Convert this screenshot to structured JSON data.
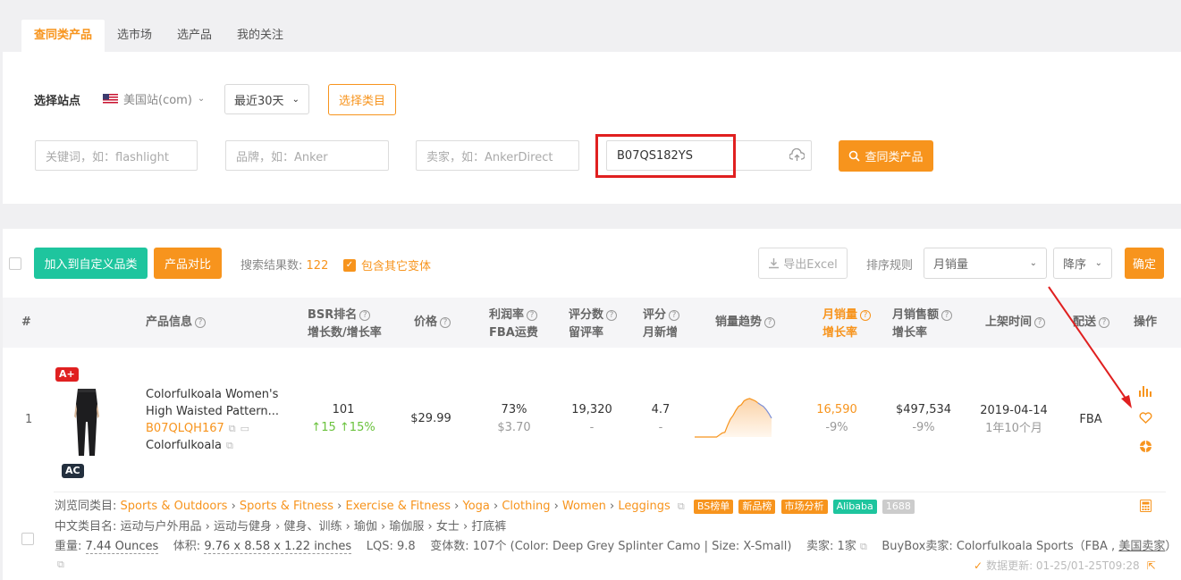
{
  "tabs": [
    {
      "label": "查同类产品",
      "active": true
    },
    {
      "label": "选市场",
      "active": false
    },
    {
      "label": "选产品",
      "active": false
    },
    {
      "label": "我的关注",
      "active": false
    }
  ],
  "filters": {
    "site_label": "选择站点",
    "site_value": "美国站(com)",
    "period_value": "最近30天",
    "category_button": "选择类目",
    "keyword_placeholder": "关键词，如：flashlight",
    "brand_placeholder": "品牌，如：Anker",
    "seller_placeholder": "卖家，如：AnkerDirect",
    "asin_value": "B07QS182YS",
    "search_button": "查同类产品"
  },
  "toolbar": {
    "add_custom": "加入到自定义品类",
    "compare": "产品对比",
    "result_label": "搜索结果数:",
    "result_count": "122",
    "include_variants": "包含其它变体",
    "export": "导出Excel",
    "sort_label": "排序规则",
    "sort_field": "月销量",
    "sort_order": "降序",
    "confirm": "确定"
  },
  "columns": {
    "index": "#",
    "product_info": "产品信息",
    "bsr_1": "BSR排名",
    "bsr_2": "增长数/增长率",
    "price": "价格",
    "margin_1": "利润率",
    "margin_2": "FBA运费",
    "reviews_1": "评分数",
    "reviews_2": "留评率",
    "rating_1": "评分",
    "rating_2": "月新增",
    "trend": "销量趋势",
    "sales_1": "月销量",
    "sales_2": "增长率",
    "revenue_1": "月销售额",
    "revenue_2": "增长率",
    "listed": "上架时间",
    "fulfill": "配送",
    "ops": "操作"
  },
  "row": {
    "index": "1",
    "badge_top": "A+",
    "badge_bottom": "AC",
    "title_1": "Colorfulkoala Women's",
    "title_2": "High Waisted Pattern...",
    "asin": "B07QLQH167",
    "brand": "Colorfulkoala",
    "bsr": "101",
    "bsr_growth": "15",
    "bsr_rate": "15%",
    "price": "$29.99",
    "margin": "73%",
    "fba_fee": "$3.70",
    "reviews": "19,320",
    "review_rate": "-",
    "rating": "4.7",
    "rating_new": "-",
    "monthly_sales": "16,590",
    "sales_growth": "-9%",
    "monthly_revenue": "$497,534",
    "revenue_growth": "-9%",
    "listed_date": "2019-04-14",
    "listed_age": "1年10个月",
    "fulfillment": "FBA"
  },
  "details": {
    "browse_label": "浏览同类目:",
    "browse_path": [
      "Sports & Outdoors",
      "Sports & Fitness",
      "Exercise & Fitness",
      "Yoga",
      "Clothing",
      "Women",
      "Leggings"
    ],
    "tags": [
      {
        "label": "BS榜单",
        "color": "#f7941d"
      },
      {
        "label": "新品榜",
        "color": "#f7941d"
      },
      {
        "label": "市场分析",
        "color": "#f7941d"
      },
      {
        "label": "Alibaba",
        "color": "#1ec59e"
      },
      {
        "label": "1688",
        "color": "#cccccc"
      }
    ],
    "cn_category_label": "中文类目名:",
    "cn_category": "运动与户外用品 › 运动与健身 › 健身、训练 › 瑜伽 › 瑜伽服 › 女士 › 打底裤",
    "weight_label": "重量:",
    "weight": "7.44 Ounces",
    "size_label": "体积:",
    "size": "9.76 x 8.58 x 1.22 inches",
    "lqs": "LQS: 9.8",
    "variants": "变体数: 107个 (Color: Deep Grey Splinter Camo | Size: X-Small)",
    "sellers": "卖家: 1家",
    "buybox_label": "BuyBox卖家:",
    "buybox_seller": "Colorfulkoala Sports",
    "buybox_fba": "（FBA ,",
    "buybox_region": "美国卖家",
    "buybox_end": "）",
    "data_update": "数据更新: 01-25/01-25T09:28"
  },
  "trend_points": [
    0,
    0,
    0,
    0,
    0,
    0,
    0,
    0,
    0,
    0.05,
    0.1,
    0.12,
    0.3,
    0.45,
    0.55,
    0.68,
    0.78,
    0.82,
    0.92,
    0.96,
    0.98,
    0.95,
    0.92,
    0.87,
    0.82,
    0.78,
    0.7,
    0.6,
    0.48
  ],
  "colors": {
    "accent": "#f7941d",
    "teal": "#1ec59e",
    "red": "#e02020",
    "green": "#6ac23d"
  }
}
